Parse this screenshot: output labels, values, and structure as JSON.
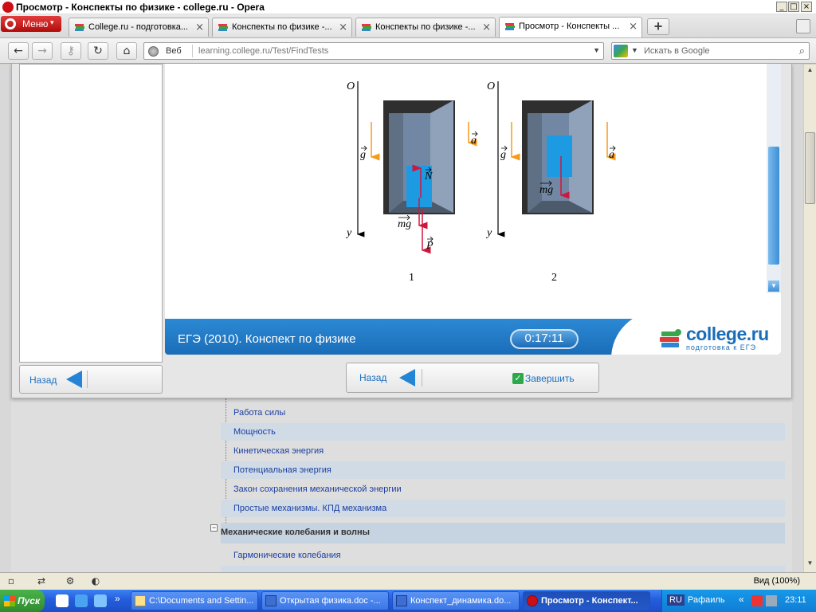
{
  "window": {
    "title": "Просмотр - Конспекты по физике - college.ru - Opera",
    "controls": [
      "_",
      "□",
      "×"
    ]
  },
  "menu_button": {
    "label": "Меню"
  },
  "tabs": [
    {
      "label": "College.ru - подготовка...",
      "close": "×"
    },
    {
      "label": "Конспекты по физике -...",
      "close": "×"
    },
    {
      "label": "Конспекты по физике -...",
      "close": "×"
    },
    {
      "label": "Просмотр - Конспекты ...",
      "close": "×",
      "active": true
    }
  ],
  "new_tab": "+",
  "nav": {
    "back": "←",
    "forward": "→",
    "reload": "↻",
    "home": "⌂",
    "address_prefix": "Веб",
    "url": "learning.college.ru/Test/FindTests",
    "search_placeholder": "Искать в Google"
  },
  "diagram": {
    "fig1": {
      "axis_o": "O",
      "axis_y": "y",
      "g": "g",
      "a": "a",
      "n": "N",
      "mg": "mg",
      "p": "P",
      "caption": "1"
    },
    "fig2": {
      "axis_o": "O",
      "axis_y": "y",
      "g": "g",
      "a": "a",
      "mg": "mg",
      "caption": "2"
    },
    "colors": {
      "accel": "#f59a1a",
      "force": "#d0163c",
      "box": "#1c9be3",
      "wall": "#303030",
      "bg": "#6a7c93"
    }
  },
  "footer": {
    "title": "ЕГЭ (2010). Конспект по физике",
    "timer": "0:17:11",
    "logo": "college.ru",
    "logo_sub": "подготовка к ЕГЭ"
  },
  "buttons": {
    "back_left": "Назад",
    "back_main": "Назад",
    "finish": "Завершить"
  },
  "list": {
    "items": [
      "Работа силы",
      "Мощность",
      "Кинетическая энергия",
      "Потенциальная энергия",
      "Закон сохранения механической энергии",
      "Простые механизмы. КПД механизма"
    ],
    "section": "Механические колебания и волны",
    "section_items": [
      "Гармонические колебания"
    ]
  },
  "statusbar": {
    "zoom": "Вид (100%)"
  },
  "taskbar": {
    "start": "Пуск",
    "tasks": [
      "C:\\Documents and Settin...",
      "Открытая физика.doc -...",
      "Конспект_динамика.do...",
      "Просмотр - Конспект..."
    ],
    "lang": "RU",
    "user": "Рафаиль",
    "clock": "23:11"
  }
}
